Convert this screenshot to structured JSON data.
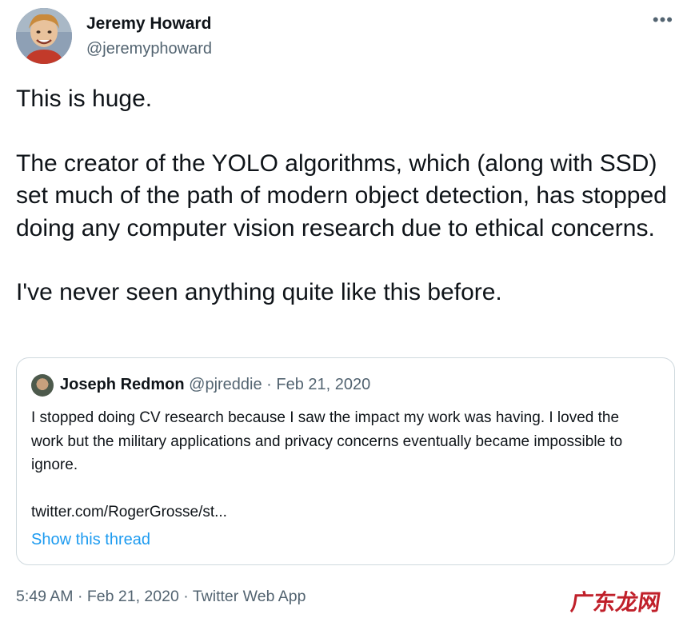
{
  "author": {
    "name": "Jeremy Howard",
    "handle": "@jeremyphoward",
    "avatar_icon": "profile-photo"
  },
  "more_icon": "ellipsis-icon",
  "more_label": "•••",
  "tweet": {
    "paragraphs": [
      "This is huge.",
      "The creator of the YOLO algorithms, which (along with SSD) set much of the path of modern object detection, has stopped doing any computer vision research due to ethical concerns.",
      "I've never seen anything quite like this before."
    ]
  },
  "quoted_tweet": {
    "author_name": "Joseph Redmon",
    "author_handle": "@pjreddie",
    "separator": "·",
    "date": "Feb 21, 2020",
    "text": "I stopped doing CV research because I saw the impact my work was having. I loved the work but the military applications and privacy concerns eventually became impossible to ignore.",
    "link": "twitter.com/RogerGrosse/st...",
    "show_thread": "Show this thread"
  },
  "footer": {
    "time": "5:49 AM",
    "separator": "·",
    "date": "Feb 21, 2020",
    "app": "Twitter Web App"
  },
  "watermark": "广东龙网",
  "colors": {
    "text": "#0f1419",
    "secondary": "#536471",
    "link": "#1d9bf0",
    "border": "#cfd9de",
    "watermark": "#c0202a"
  }
}
